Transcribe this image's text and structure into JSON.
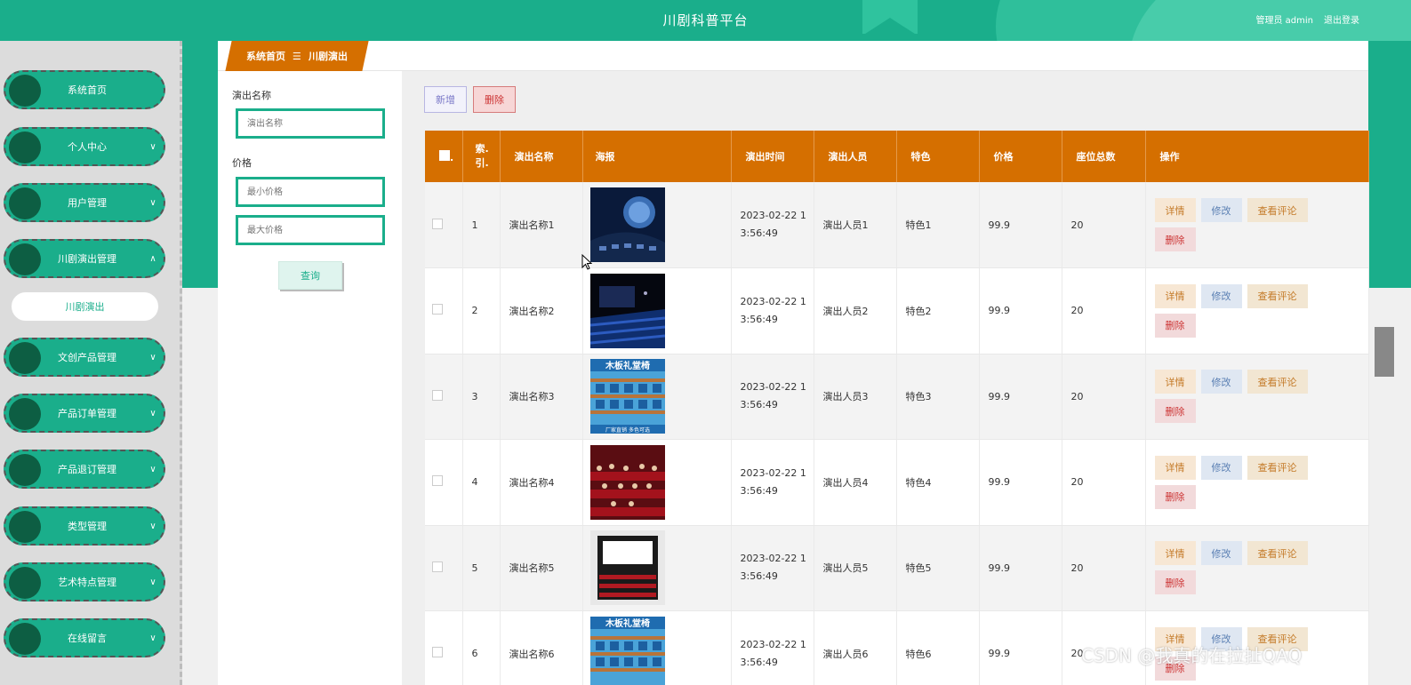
{
  "header": {
    "title": "川剧科普平台",
    "user_label": "管理员 admin",
    "logout_label": "退出登录"
  },
  "breadcrumb": {
    "home": "系统首页",
    "separator": "☰",
    "current": "川剧演出"
  },
  "sidebar": {
    "items": [
      {
        "label": "系统首页",
        "chevron": ""
      },
      {
        "label": "个人中心",
        "chevron": "∨"
      },
      {
        "label": "用户管理",
        "chevron": "∨"
      },
      {
        "label": "川剧演出管理",
        "chevron": "∧"
      },
      {
        "label": "文创产品管理",
        "chevron": "∨"
      },
      {
        "label": "产品订单管理",
        "chevron": "∨"
      },
      {
        "label": "产品退订管理",
        "chevron": "∨"
      },
      {
        "label": "类型管理",
        "chevron": "∨"
      },
      {
        "label": "艺术特点管理",
        "chevron": "∨"
      },
      {
        "label": "在线留言",
        "chevron": "∨"
      }
    ],
    "submenu_active": "川剧演出"
  },
  "search": {
    "name_label": "演出名称",
    "name_placeholder": "演出名称",
    "price_label": "价格",
    "min_placeholder": "最小价格",
    "max_placeholder": "最大价格",
    "query_button": "查询"
  },
  "toolbar": {
    "add_label": "新增",
    "delete_label": "删除"
  },
  "table": {
    "headers": [
      "索引",
      "演出名称",
      "海报",
      "演出时间",
      "演出人员",
      "特色",
      "价格",
      "座位总数",
      "操作"
    ],
    "index_header_top": "索.",
    "index_header_bottom": "引.",
    "checkbox_suffix": ".",
    "ops": {
      "detail": "详情",
      "edit": "修改",
      "review": "查看评论",
      "remove": "删除"
    },
    "rows": [
      {
        "index": "1",
        "name": "演出名称1",
        "poster": "space",
        "time": "2023-02-22 13:56:49",
        "performer": "演出人员1",
        "feature": "特色1",
        "price": "99.9",
        "seats": "20"
      },
      {
        "index": "2",
        "name": "演出名称2",
        "poster": "cinema",
        "time": "2023-02-22 13:56:49",
        "performer": "演出人员2",
        "feature": "特色2",
        "price": "99.9",
        "seats": "20"
      },
      {
        "index": "3",
        "name": "演出名称3",
        "poster": "chairs",
        "poster_text": "木板礼堂椅",
        "poster_subtext": "厂家直销 多色可选",
        "time": "2023-02-22 13:56:49",
        "performer": "演出人员3",
        "feature": "特色3",
        "price": "99.9",
        "seats": "20"
      },
      {
        "index": "4",
        "name": "演出名称4",
        "poster": "audience",
        "time": "2023-02-22 13:56:49",
        "performer": "演出人员4",
        "feature": "特色4",
        "price": "99.9",
        "seats": "20"
      },
      {
        "index": "5",
        "name": "演出名称5",
        "poster": "screen",
        "time": "2023-02-22 13:56:49",
        "performer": "演出人员5",
        "feature": "特色5",
        "price": "99.9",
        "seats": "20"
      },
      {
        "index": "6",
        "name": "演出名称6",
        "poster": "chairs",
        "poster_text": "木板礼堂椅",
        "poster_subtext": "",
        "time": "2023-02-22 13:56:49",
        "performer": "演出人员6",
        "feature": "特色6",
        "price": "99.9",
        "seats": "20"
      }
    ]
  },
  "watermark": "CSDN @我真的在拉扯QAQ",
  "colors": {
    "brand_green": "#1aae8b",
    "accent_orange": "#d56f00",
    "dark_dot": "#0d5e43"
  }
}
